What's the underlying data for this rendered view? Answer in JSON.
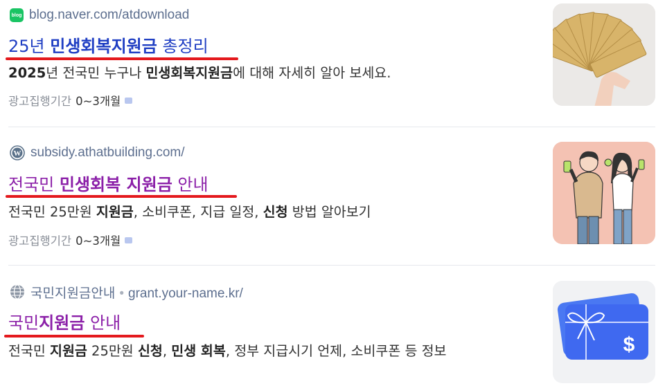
{
  "results": [
    {
      "source": "blog.naver.com/atdownload",
      "favicon": "naver-blog-icon",
      "favicon_text": "blog",
      "title_parts": [
        {
          "text": "25년 ",
          "bold": false
        },
        {
          "text": "민생회복지원금",
          "bold": true
        },
        {
          "text": " 총정리",
          "bold": false
        }
      ],
      "title_color": "#1f3ec3",
      "desc_parts": [
        {
          "text": "2025",
          "bold": true
        },
        {
          "text": "년 전국민 누구나 ",
          "bold": false
        },
        {
          "text": "민생회복지원금",
          "bold": true
        },
        {
          "text": "에 대해 자세히 알아 보세요.",
          "bold": false
        }
      ],
      "ad_label": "광고집행기간",
      "ad_period": "0~3개월",
      "thumbnail": "cash-fan-image"
    },
    {
      "source": "subsidy.athatbuilding.com/",
      "favicon": "wordpress-icon",
      "title_parts": [
        {
          "text": "전국민 ",
          "bold": false
        },
        {
          "text": "민생회복 지원금",
          "bold": true
        },
        {
          "text": " 안내",
          "bold": false
        }
      ],
      "title_color": "#8b1fa8",
      "desc_parts": [
        {
          "text": "전국민 25만원 ",
          "bold": false
        },
        {
          "text": "지원금",
          "bold": true
        },
        {
          "text": ", 소비쿠폰, 지급 일정, ",
          "bold": false
        },
        {
          "text": "신청",
          "bold": true
        },
        {
          "text": " 방법 알아보기",
          "bold": false
        }
      ],
      "ad_label": "광고집행기간",
      "ad_period": "0~3개월",
      "thumbnail": "couple-illustration-image"
    },
    {
      "source": "국민지원금안내",
      "source_url": "grant.your-name.kr/",
      "favicon": "globe-icon",
      "title_parts": [
        {
          "text": "국민",
          "bold": false
        },
        {
          "text": "지원금",
          "bold": true
        },
        {
          "text": " 안내",
          "bold": false
        }
      ],
      "title_color": "#8b1fa8",
      "desc_parts": [
        {
          "text": "전국민 ",
          "bold": false
        },
        {
          "text": "지원금",
          "bold": true
        },
        {
          "text": " 25만원 ",
          "bold": false
        },
        {
          "text": "신청",
          "bold": true
        },
        {
          "text": ", ",
          "bold": false
        },
        {
          "text": "민생 회복",
          "bold": true
        },
        {
          "text": ", 정부 지급시기 언제, 소비쿠폰 등 정보",
          "bold": false
        }
      ],
      "thumbnail": "gift-card-image"
    }
  ],
  "colors": {
    "underline": "#e4191d",
    "link_blue": "#1f3ec3",
    "visited_purple": "#8b1fa8"
  }
}
